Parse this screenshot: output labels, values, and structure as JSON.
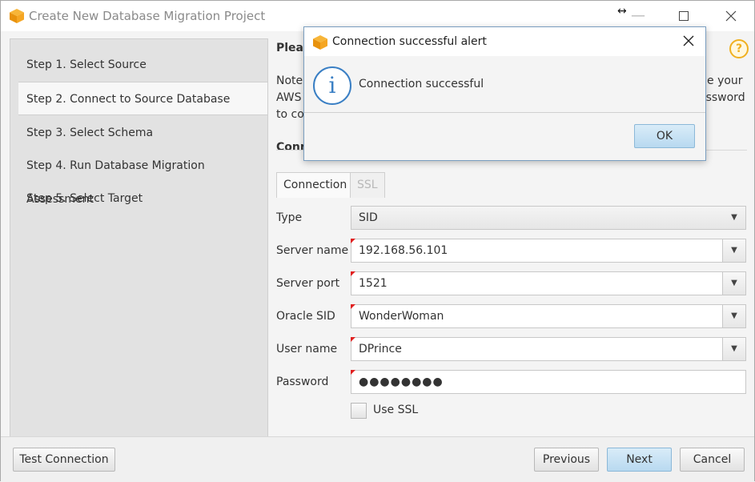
{
  "window": {
    "title": "Create New Database Migration Project"
  },
  "sidebar": {
    "steps": [
      {
        "label": "Step 1. Select Source"
      },
      {
        "label": "Step 2. Connect to Source Database"
      },
      {
        "label": "Step 3. Select Schema"
      },
      {
        "label": "Step 4. Run Database Migration Assessment"
      },
      {
        "label": "Step 5. Select Target"
      }
    ]
  },
  "background_content": {
    "heading_fragment": "Pleas",
    "note_line1_left": "Note",
    "note_line1_right": "e your",
    "note_line2_left": "AWS",
    "note_line2_right": "assword",
    "note_line3_left": "to co",
    "section_fragment": "Conn"
  },
  "tabs": {
    "connection": "Connection",
    "ssl": "SSL"
  },
  "form": {
    "type_label": "Type",
    "type_value": "SID",
    "server_name_label": "Server name",
    "server_name_value": "192.168.56.101",
    "server_port_label": "Server port",
    "server_port_value": "1521",
    "oracle_sid_label": "Oracle SID",
    "oracle_sid_value": "WonderWoman",
    "user_name_label": "User name",
    "user_name_value": "DPrince",
    "password_label": "Password",
    "password_value": "●●●●●●●●",
    "use_ssl_label": "Use SSL"
  },
  "footer": {
    "test_connection": "Test Connection",
    "previous": "Previous",
    "next": "Next",
    "cancel": "Cancel"
  },
  "dialog": {
    "title": "Connection successful alert",
    "message": "Connection successful",
    "ok": "OK"
  },
  "colors": {
    "accent_blue": "#b8d9f0",
    "required_marker": "#e02020",
    "help_icon": "#f0b020",
    "info_icon": "#3a7fc4"
  }
}
